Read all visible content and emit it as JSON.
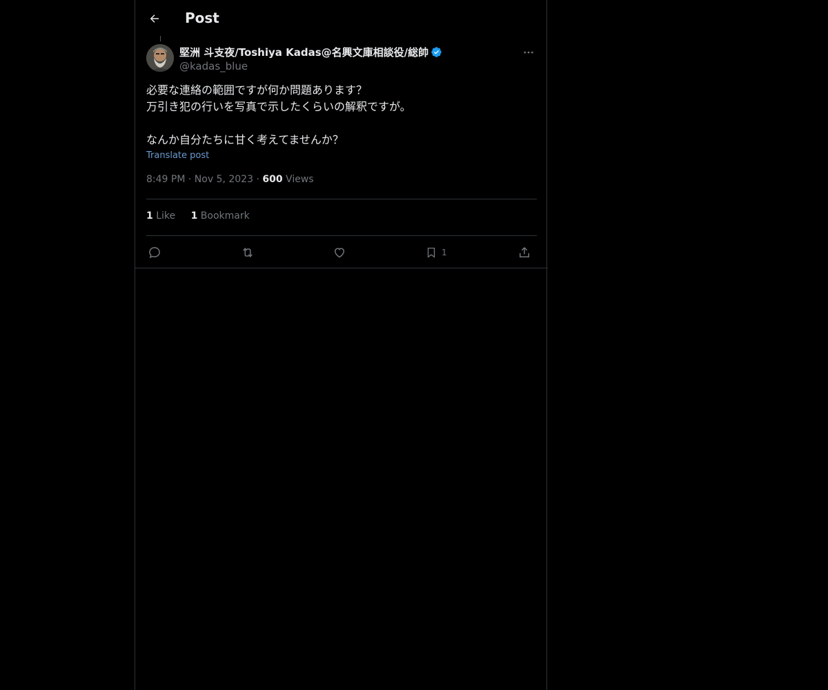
{
  "header": {
    "title": "Post",
    "back_icon": "arrow-left-icon"
  },
  "tweet": {
    "author": {
      "display_name": "堅洲 斗支夜/Toshiya Kadas@名興文庫相談役/総帥",
      "handle": "@kadas_blue",
      "verified": true,
      "verified_color": "#1d9bf0"
    },
    "body_lines": [
      "必要な連絡の範囲ですが何か問題あります？",
      "万引き犯の行いを写真で示したくらいの解釈ですが。",
      "",
      "なんか自分たちに甘く考えてませんか？"
    ],
    "translate_label": "Translate post",
    "time": "8:49 PM",
    "separator": "·",
    "date": "Nov 5, 2023",
    "views_count": "600",
    "views_label": "Views",
    "stats": {
      "likes_count": "1",
      "likes_label": "Like",
      "bookmarks_count": "1",
      "bookmarks_label": "Bookmark"
    },
    "actions": {
      "reply_icon": "reply-icon",
      "retweet_icon": "retweet-icon",
      "like_icon": "heart-icon",
      "bookmark_icon": "bookmark-icon",
      "bookmark_count": "1",
      "share_icon": "share-icon"
    }
  },
  "colors": {
    "background": "#000000",
    "text": "#e7e9ea",
    "muted": "#71767b",
    "link": "#6b9bd1",
    "border": "#2f3336"
  }
}
